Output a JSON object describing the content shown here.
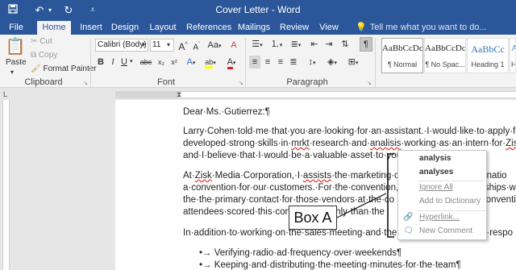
{
  "window": {
    "title": "Cover Letter - Word"
  },
  "quick_access": {
    "save_icon": "save-icon",
    "undo_icon": "undo-icon",
    "redo_icon": "redo-icon",
    "customize_icon": "customize-icon"
  },
  "tabs": [
    "File",
    "Home",
    "Insert",
    "Design",
    "Layout",
    "References",
    "Mailings",
    "Review",
    "View"
  ],
  "tell_me": "Tell me what you want to do...",
  "ribbon": {
    "clipboard": {
      "paste": "Paste",
      "cut": "Cut",
      "copy": "Copy",
      "format_painter": "Format Painter",
      "label": "Clipboard"
    },
    "font": {
      "name": "Calibri (Body)",
      "size": "11",
      "grow": "A",
      "shrink": "A",
      "case": "Aa",
      "clear": "A",
      "bold": "B",
      "italic": "I",
      "underline": "U",
      "strike": "abc",
      "subscript": "x₂",
      "superscript": "x²",
      "effects": "A",
      "highlight": "ab",
      "color": "A",
      "label": "Font"
    },
    "paragraph": {
      "label": "Paragraph",
      "show_marks": "¶"
    },
    "styles": [
      {
        "sample": "AaBbCcDc",
        "name": "¶ Normal"
      },
      {
        "sample": "AaBbCcDc",
        "name": "¶ No Spac..."
      },
      {
        "sample": "AaBbCc",
        "name": "Heading 1"
      },
      {
        "sample": "A",
        "name": "H"
      }
    ]
  },
  "document": {
    "salutation": "Dear·Ms.·Gutierrez:¶",
    "p1": [
      [
        "Larry·Cohen·told·me·that·you·are·looking·for·an·assistant.·I·would·like·to·apply·fo"
      ],
      [
        "developed·strong·skills·in·",
        "mrkt",
        "·research·and·",
        "analisis",
        "·working·as·an·intern·for·",
        "Zisk"
      ],
      [
        "and·I·believe·that·I·would·be·a·valuable·asset·to·you"
      ]
    ],
    "p2": [
      [
        "At·",
        "Zisk",
        "·Media·Corporation,·I·",
        "assists",
        "·the·marketing·co",
        "ng·natio"
      ],
      [
        "a·convention·for·our·customers.·For·the·convention,",
        "rships·w"
      ],
      [
        "the·the·primary·contact·for·those·vendors·at·the·co",
        "conventi"
      ],
      [
        "attendees·scored·this·convention·highly·than·the"
      ]
    ],
    "p3": [
      "In·addition·to·working·on·the·sales·meeting·and·the",
      "o·respo"
    ],
    "bullets": [
      "Verifying·radio·ad·frequency·over·weekends¶",
      "Keeping·and·distributing·the·meeting·minutes·for·the·team¶"
    ]
  },
  "context_menu": {
    "suggestions": [
      "analysis",
      "analyses"
    ],
    "ignore_all": "Ignore All",
    "add_to_dictionary": "Add to Dictionary",
    "hyperlink": "Hyperlink...",
    "new_comment": "New Comment"
  },
  "annotation": {
    "label": "Box A"
  },
  "colors": {
    "title_bar": "#2b579a",
    "accent": "#2b579a",
    "spelling": "#d33333"
  }
}
